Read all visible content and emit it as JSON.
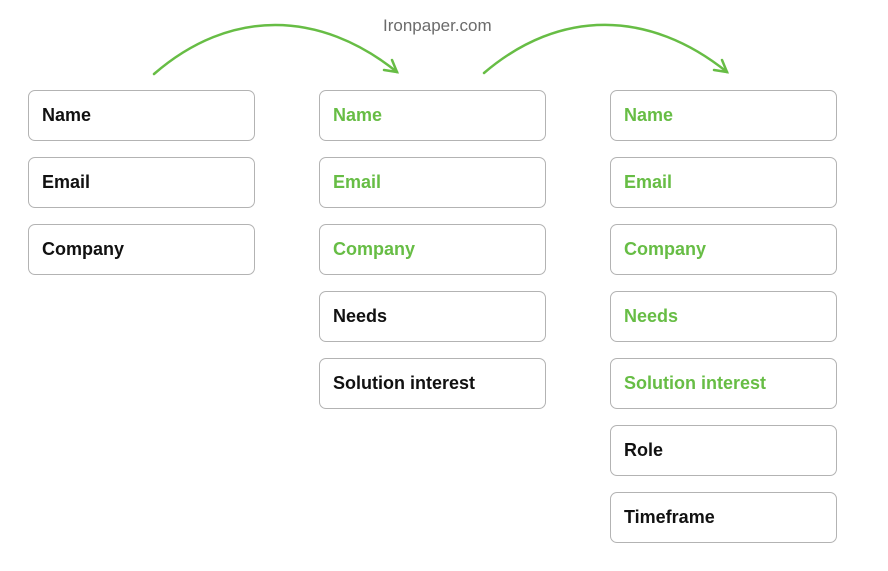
{
  "watermark": "Ironpaper.com",
  "colors": {
    "carried": "#67bd45",
    "new": "#111111",
    "arrow": "#67bd45"
  },
  "forms": [
    {
      "fields": [
        {
          "label": "Name",
          "carried": false
        },
        {
          "label": "Email",
          "carried": false
        },
        {
          "label": "Company",
          "carried": false
        }
      ]
    },
    {
      "fields": [
        {
          "label": "Name",
          "carried": true
        },
        {
          "label": "Email",
          "carried": true
        },
        {
          "label": "Company",
          "carried": true
        },
        {
          "label": "Needs",
          "carried": false
        },
        {
          "label": "Solution interest",
          "carried": false
        }
      ]
    },
    {
      "fields": [
        {
          "label": "Name",
          "carried": true
        },
        {
          "label": "Email",
          "carried": true
        },
        {
          "label": "Company",
          "carried": true
        },
        {
          "label": "Needs",
          "carried": true
        },
        {
          "label": "Solution interest",
          "carried": true
        },
        {
          "label": "Role",
          "carried": false
        },
        {
          "label": "Timeframe",
          "carried": false
        }
      ]
    }
  ]
}
